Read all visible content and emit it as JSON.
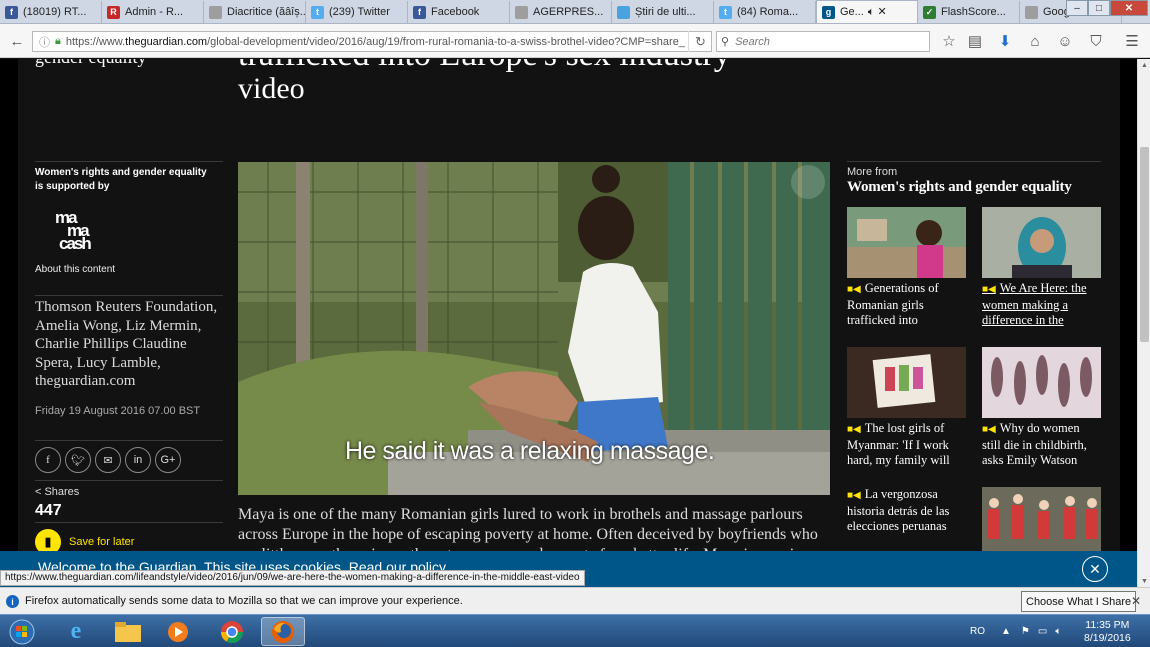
{
  "browser": {
    "tabs": [
      {
        "label": "(18019) RT...",
        "fav_color": "#3b5998",
        "fav": "f"
      },
      {
        "label": "Admin - R...",
        "fav_color": "#c62828",
        "fav": "R"
      },
      {
        "label": "Diacritice (ăâîș...",
        "fav_color": "#9e9e9e",
        "fav": ""
      },
      {
        "label": "(239) Twitter",
        "fav_color": "#55acee",
        "fav": "t"
      },
      {
        "label": "Facebook",
        "fav_color": "#3b5998",
        "fav": "f"
      },
      {
        "label": "AGERPRES...",
        "fav_color": "#9e9e9e",
        "fav": ""
      },
      {
        "label": "Știri de ulti...",
        "fav_color": "#4aa3df",
        "fav": ""
      },
      {
        "label": "(84) Roma...",
        "fav_color": "#55acee",
        "fav": "t"
      },
      {
        "label": "Ge...",
        "fav_color": "#005689",
        "fav": "g",
        "active": true
      },
      {
        "label": "FlashScore...",
        "fav_color": "#2e7d32",
        "fav": "✓"
      },
      {
        "label": "Google Tr...",
        "fav_color": "#9e9e9e",
        "fav": ""
      }
    ],
    "url_prefix": "https://www.",
    "url_host": "theguardian.com",
    "url_path": "/global-development/video/2016/aug/19/from-rural-romania-to-a-swiss-brothel-video?CMP=share_",
    "search_placeholder": "Search"
  },
  "article": {
    "title_line_top": "trafficked into Europe's sex industry",
    "title_line_bottom": "video",
    "left_cut_text": "gender equality",
    "supported_text": "Women's rights and gender equality is supported by",
    "logo_text": "ma ma cash",
    "about_label": "About this content",
    "byline": "Thomson Reuters Foundation, Amelia Wong, Liz Mermin, Charlie Phillips Claudine Spera, Lucy Lamble, theguardian.com",
    "date": "Friday 19 August 2016 07.00 BST",
    "social_icons": [
      "facebook-icon",
      "twitter-icon",
      "email-icon",
      "linkedin-icon",
      "googleplus-icon"
    ],
    "shares_label": "Shares",
    "shares_count": "447",
    "save_label": "Save for later",
    "video_caption": "He said it was a relaxing massage.",
    "body_text": "Maya is one of the many Romanian girls lured to work in brothels and massage parlours across Europe in the hope of escaping poverty at home. Often deceived by boyfriends who are little more than pimps, these teenagers are desperate for a better life. Maya is now in a"
  },
  "sidebar": {
    "more_from": "More from",
    "section_title": "Women's rights and gender equality",
    "cards": [
      {
        "title": "Generations of Romanian girls trafficked into",
        "underlined": false
      },
      {
        "title": "We Are Here: the women making a difference in the",
        "underlined": true
      },
      {
        "title": "The lost girls of Myanmar: 'If I work hard, my family will",
        "underlined": false
      },
      {
        "title": "Why do women still die in childbirth, asks Emily Watson",
        "underlined": false
      },
      {
        "title": "La vergonzosa historia detrás de las elecciones peruanas",
        "underlined": false
      },
      {
        "title": "",
        "underlined": false
      }
    ]
  },
  "cookie_bar": {
    "message": "Welcome to the Guardian. This site uses cookies. Read our policy."
  },
  "status_url": "https://www.theguardian.com/lifeandstyle/video/2016/jun/09/we-are-here-the-women-making-a-difference-in-the-middle-east-video",
  "notification": {
    "message": "Firefox automatically sends some data to Mozilla so that we can improve your experience.",
    "button": "Choose What I Share"
  },
  "taskbar": {
    "language": "RO",
    "time": "11:35 PM",
    "date": "8/19/2016"
  }
}
